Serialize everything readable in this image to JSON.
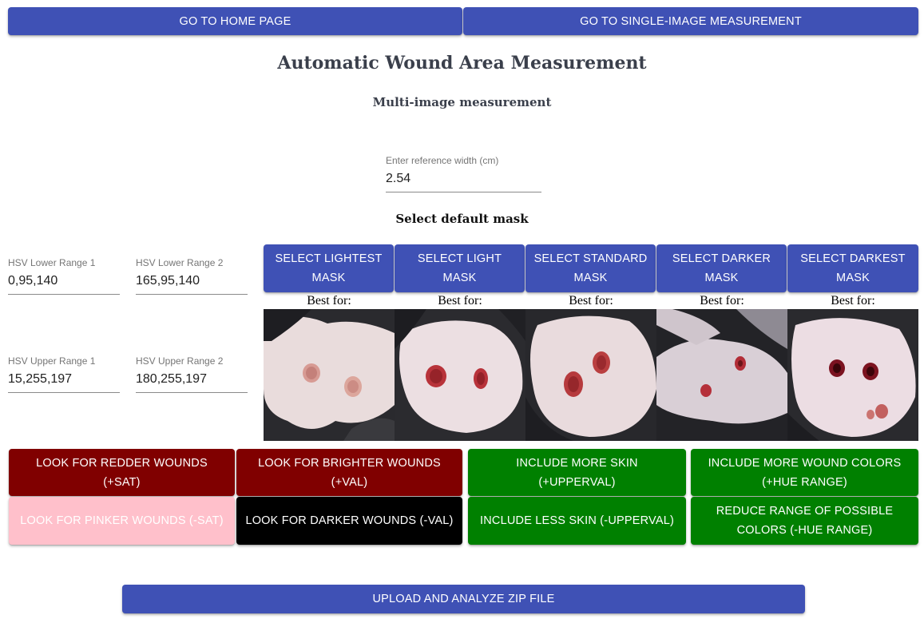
{
  "nav": {
    "home_label": "GO TO HOME PAGE",
    "single_label": "GO TO SINGLE-IMAGE MEASUREMENT"
  },
  "header": {
    "title": "Automatic Wound Area Measurement",
    "subtitle": "Multi-image measurement"
  },
  "reference": {
    "label": "Enter reference width (cm)",
    "value": "2.54"
  },
  "mask_section": {
    "label": "Select default mask",
    "best_for": "Best for:",
    "masks": [
      {
        "label": "SELECT LIGHTEST MASK"
      },
      {
        "label": "SELECT LIGHT MASK"
      },
      {
        "label": "SELECT STANDARD MASK"
      },
      {
        "label": "SELECT DARKER MASK"
      },
      {
        "label": "SELECT DARKEST MASK"
      }
    ]
  },
  "hsv": {
    "lower1": {
      "label": "HSV Lower Range 1",
      "value": "0,95,140"
    },
    "lower2": {
      "label": "HSV Lower Range 2",
      "value": "165,95,140"
    },
    "upper1": {
      "label": "HSV Upper Range 1",
      "value": "15,255,197"
    },
    "upper2": {
      "label": "HSV Upper Range 2",
      "value": "180,255,197"
    }
  },
  "adjust": {
    "redder": "LOOK FOR REDDER WOUNDS (+SAT)",
    "brighter": "LOOK FOR BRIGHTER WOUNDS (+VAL)",
    "more_skin": "INCLUDE MORE SKIN (+UPPERVAL)",
    "more_colors": "INCLUDE MORE WOUND COLORS (+HUE RANGE)",
    "pinker": "LOOK FOR PINKER WOUNDS (-SAT)",
    "darker": "LOOK FOR DARKER WOUNDS (-VAL)",
    "less_skin": "INCLUDE LESS SKIN (-UPPERVAL)",
    "reduce_colors": "REDUCE RANGE OF POSSIBLE COLORS (-HUE RANGE)"
  },
  "upload": {
    "label": "UPLOAD AND ANALYZE ZIP FILE"
  },
  "colors": {
    "primary": "#3f51b5",
    "dark_red": "#800000",
    "green": "#008000",
    "pink": "#ffc0cb",
    "black": "#000000"
  }
}
